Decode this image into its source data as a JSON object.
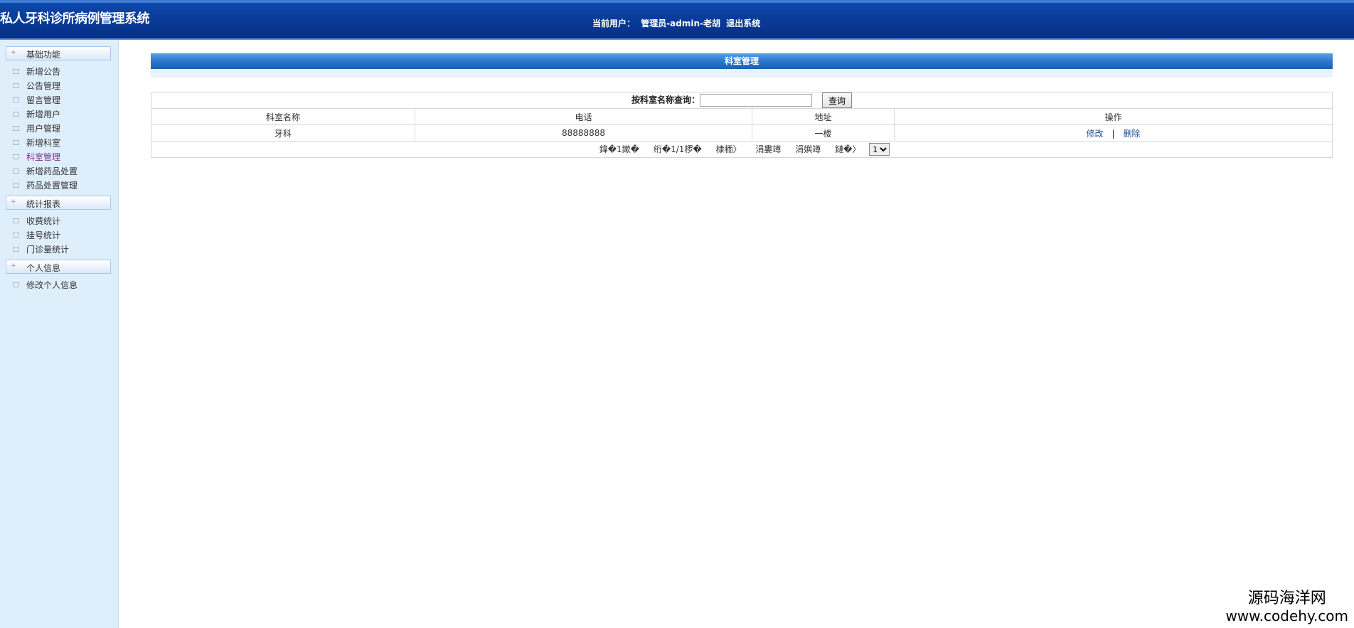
{
  "header": {
    "app_title": "私人牙科诊所病例管理系统",
    "current_user_label": "当前用户：",
    "current_user_value": "管理员-admin-老胡",
    "logout_label": "退出系统"
  },
  "sidebar": {
    "groups": [
      {
        "label": "基础功能",
        "items": [
          {
            "label": "新增公告"
          },
          {
            "label": "公告管理"
          },
          {
            "label": "留言管理"
          },
          {
            "label": "新增用户"
          },
          {
            "label": "用户管理"
          },
          {
            "label": "新增科室"
          },
          {
            "label": "科室管理",
            "active": true
          },
          {
            "label": "新增药品处置"
          },
          {
            "label": "药品处置管理"
          }
        ]
      },
      {
        "label": "统计报表",
        "items": [
          {
            "label": "收费统计"
          },
          {
            "label": "挂号统计"
          },
          {
            "label": "门诊量统计"
          }
        ]
      },
      {
        "label": "个人信息",
        "items": [
          {
            "label": "修改个人信息"
          }
        ]
      }
    ]
  },
  "main": {
    "panel_title": "科室管理",
    "search": {
      "label": "按科室名称查询：",
      "value": "",
      "button": "查询"
    },
    "table": {
      "columns": [
        "科室名称",
        "电话",
        "地址",
        "操作"
      ],
      "rows": [
        {
          "name": "牙科",
          "phone": "88888888",
          "address": "一楼",
          "edit": "修改",
          "sep": "|",
          "delete": "删除"
        }
      ]
    },
    "pager": {
      "total": "鍏�1鏉�",
      "page": "绗�1/1椤�",
      "first": "棣栭〉",
      "prev": "涓婁竴",
      "next": "涓嬩竴",
      "last": "鏈�〉",
      "select_value": "1"
    }
  },
  "watermark": {
    "line1": "源码海洋网",
    "line2": "www.codehy.com"
  }
}
